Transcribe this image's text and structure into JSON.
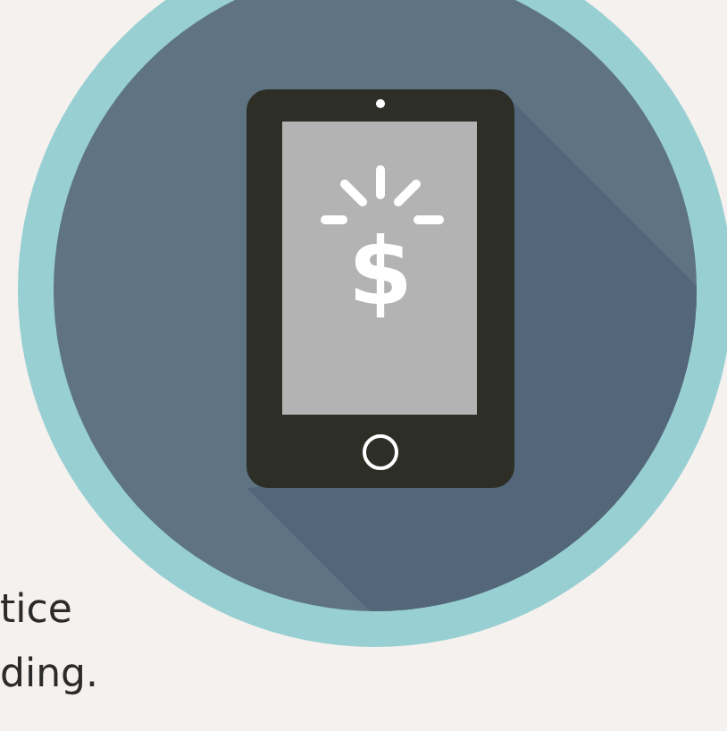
{
  "illustration": {
    "screen_symbol": "$"
  },
  "paragraph_lines": [
    "tice",
    "ding."
  ]
}
